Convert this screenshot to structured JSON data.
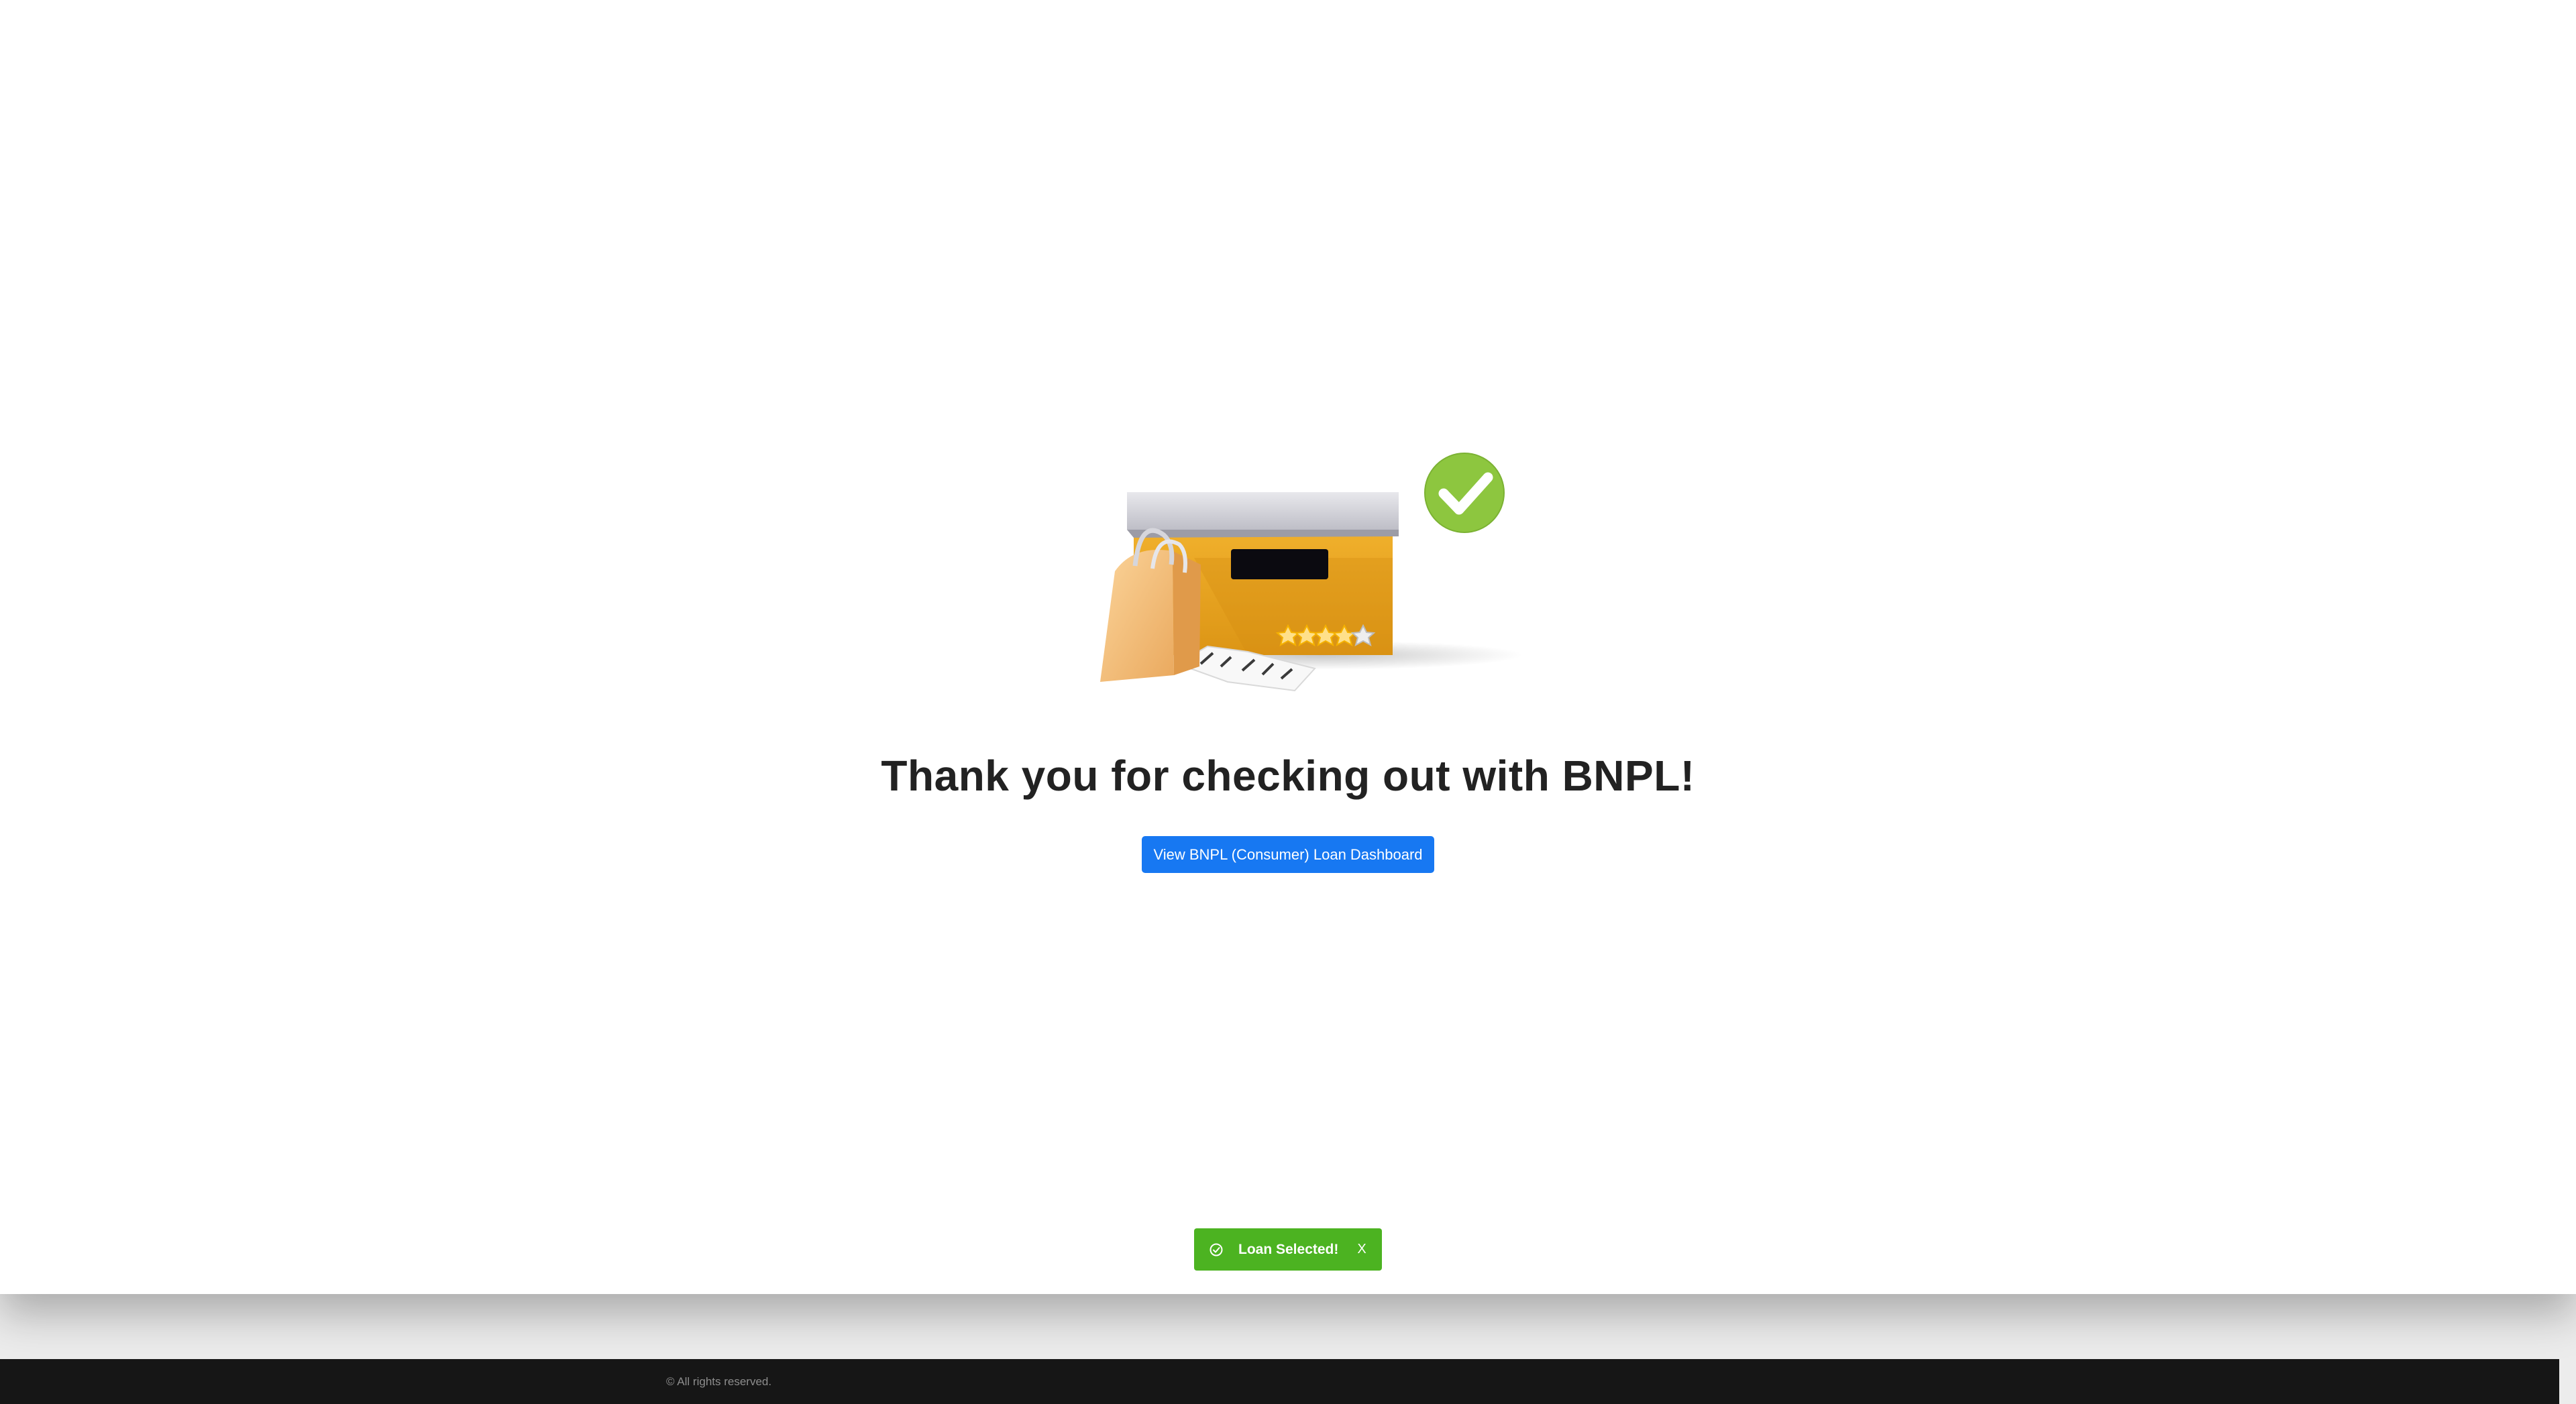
{
  "main": {
    "heading": "Thank you for checking out with BNPL!",
    "dashboard_button_label": "View BNPL (Consumer) Loan Dashboard",
    "illustration": {
      "icon": "order-box-check-icon",
      "rating_stars": 5
    }
  },
  "toast": {
    "message": "Loan Selected!",
    "close_label": "X",
    "icon": "check-circle-icon"
  },
  "footer": {
    "copyright": "© All rights reserved."
  },
  "colors": {
    "primary_button": "#1778f2",
    "toast_success": "#4cb321",
    "check_badge": "#8dc63f",
    "box_orange": "#e9a020",
    "footer_bg": "#161616"
  }
}
